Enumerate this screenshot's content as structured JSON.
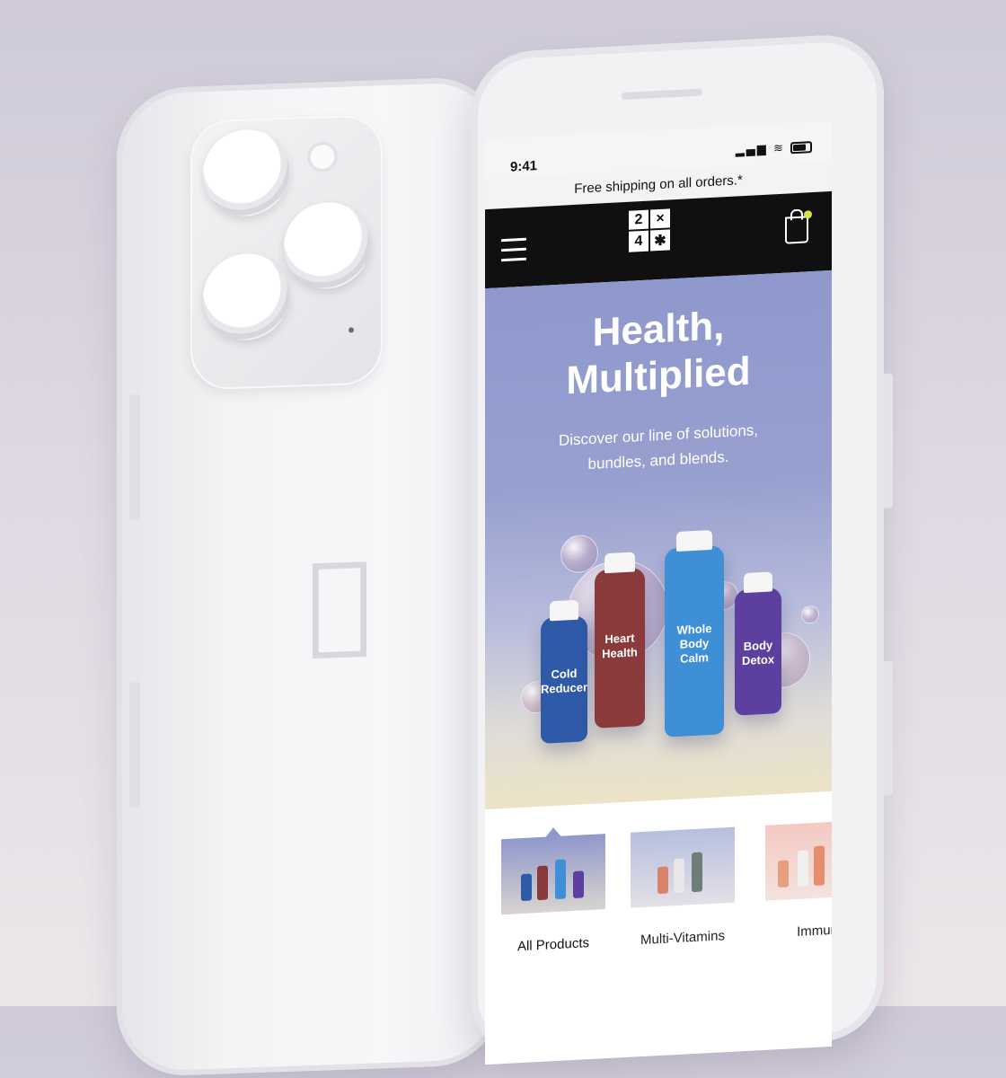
{
  "status_bar": {
    "time": "9:41"
  },
  "banner": {
    "text": "Free shipping on all orders.*"
  },
  "logo": {
    "cells": [
      "2",
      "×",
      "4",
      "✱"
    ]
  },
  "hero": {
    "title_line1": "Health,",
    "title_line2": "Multiplied",
    "subtitle_line1": "Discover our line of solutions,",
    "subtitle_line2": "bundles, and blends."
  },
  "products": [
    {
      "line1": "Cold",
      "line2": "Reducer",
      "color": "#2f5aa8"
    },
    {
      "line1": "Heart",
      "line2": "Health",
      "color": "#8a3a3a"
    },
    {
      "line1": "Whole Body",
      "line2": "Calm",
      "color": "#3f8fd6"
    },
    {
      "line1": "Body",
      "line2": "Detox",
      "color": "#5d3fa0"
    }
  ],
  "categories": [
    {
      "name": "All Products",
      "active": true
    },
    {
      "name": "Multi-Vitamins",
      "active": false
    },
    {
      "name": "Immun",
      "active": false
    }
  ],
  "colors": {
    "hero_bg": "#8f98cc",
    "header_bg": "#101010",
    "cart_dot": "#d8e24a"
  },
  "icons": [
    "hamburger-menu-icon",
    "shopping-bag-icon",
    "wifi-icon",
    "signal-icon",
    "battery-icon",
    "apple-logo-icon"
  ]
}
